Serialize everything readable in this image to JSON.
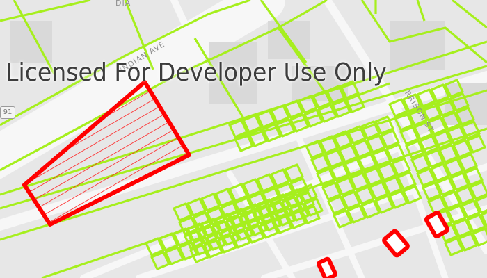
{
  "map": {
    "watermark": "Licensed For Developer Use Only",
    "street_labels": {
      "top_partial": "DIA",
      "indian_ave": "INDIAN AVE",
      "morrison_st": "RRISON ST"
    },
    "highway_shield": "91",
    "colors": {
      "background": "#e7e7e7",
      "road": "#f7f7f7",
      "parcel_outline": "#a6ef1d",
      "selected_outline": "#ff0000",
      "building": "#d9d9d9"
    },
    "selected_features": [
      {
        "name": "selected-parcel-large",
        "style": "hatched"
      },
      {
        "name": "selected-parcel-small-1",
        "style": "outline"
      },
      {
        "name": "selected-parcel-small-2",
        "style": "outline"
      },
      {
        "name": "selected-parcel-small-3",
        "style": "outline"
      }
    ]
  }
}
